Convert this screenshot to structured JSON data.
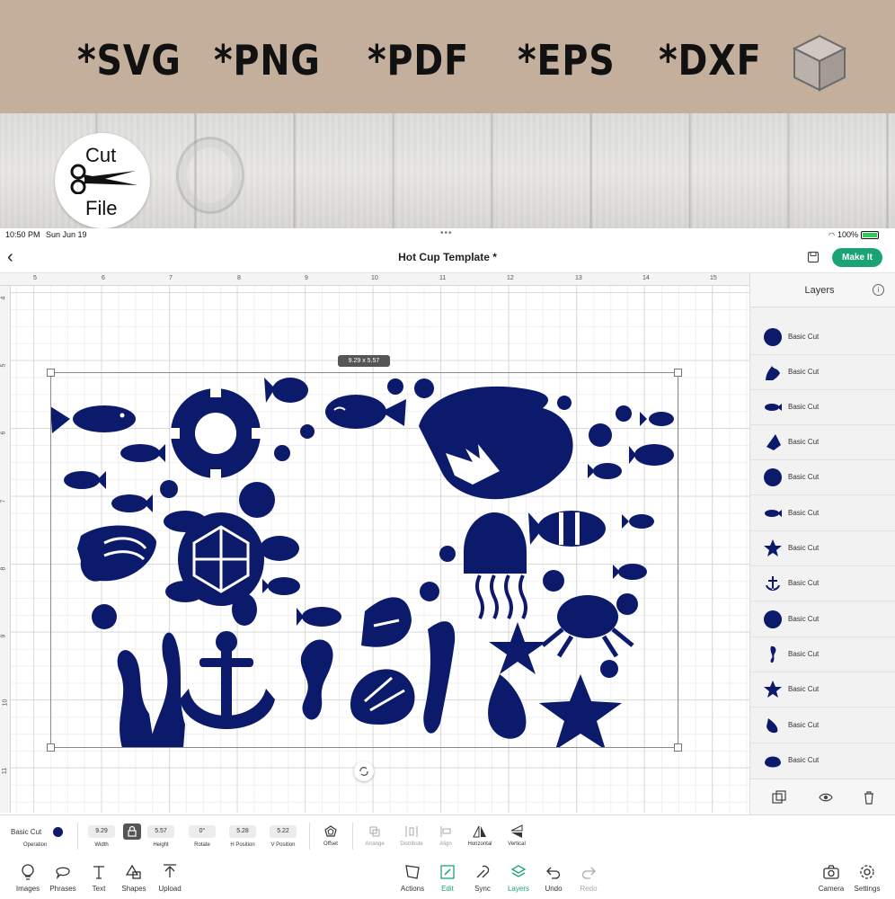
{
  "banner": {
    "formats": [
      "*SVG",
      "*PNG",
      "*PDF",
      "*EPS",
      "*DXF"
    ],
    "badge_line1": "Cut",
    "badge_line2": "File"
  },
  "status_bar": {
    "time": "10:50 PM",
    "date": "Sun Jun 19",
    "battery": "100%"
  },
  "top_nav": {
    "title": "Hot Cup Template *",
    "make_it": "Make It"
  },
  "canvas": {
    "ruler_h": [
      "5",
      "6",
      "7",
      "8",
      "9",
      "10",
      "11",
      "12",
      "13",
      "14",
      "15"
    ],
    "ruler_v": [
      "4",
      "5",
      "6",
      "7",
      "8",
      "9",
      "10",
      "11"
    ],
    "selection_dims": "9.29 x 5.57"
  },
  "layers": {
    "title": "Layers",
    "items": [
      {
        "label": "Basic Cut",
        "icon": "bubble-icon"
      },
      {
        "label": "Basic Cut",
        "icon": "coral-icon"
      },
      {
        "label": "Basic Cut",
        "icon": "fish-icon"
      },
      {
        "label": "Basic Cut",
        "icon": "angelfish-icon"
      },
      {
        "label": "Basic Cut",
        "icon": "bubble-icon"
      },
      {
        "label": "Basic Cut",
        "icon": "fish-icon"
      },
      {
        "label": "Basic Cut",
        "icon": "starfish-icon"
      },
      {
        "label": "Basic Cut",
        "icon": "anchor-icon"
      },
      {
        "label": "Basic Cut",
        "icon": "bubble-icon"
      },
      {
        "label": "Basic Cut",
        "icon": "seahorse-icon"
      },
      {
        "label": "Basic Cut",
        "icon": "starfish-icon"
      },
      {
        "label": "Basic Cut",
        "icon": "shell-icon"
      },
      {
        "label": "Basic Cut",
        "icon": "scallop-icon"
      }
    ]
  },
  "edit_bar": {
    "operation_value": "Basic Cut",
    "operation_label": "Operation",
    "width_value": "9.29",
    "width_label": "Width",
    "height_value": "5.57",
    "height_label": "Height",
    "rotate_value": "0°",
    "rotate_label": "Rotate",
    "hpos_value": "5.28",
    "hpos_label": "H Position",
    "vpos_value": "5.22",
    "vpos_label": "V Position",
    "offset": "Offset",
    "arrange": "Arrange",
    "distribute": "Distribute",
    "align": "Align",
    "horizontal": "Horizontal",
    "vertical": "Vertical"
  },
  "main_bar": {
    "images": "Images",
    "phrases": "Phrases",
    "text": "Text",
    "shapes": "Shapes",
    "upload": "Upload",
    "actions": "Actions",
    "edit": "Edit",
    "sync": "Sync",
    "layers": "Layers",
    "undo": "Undo",
    "redo": "Redo",
    "camera": "Camera",
    "settings": "Settings"
  },
  "colors": {
    "accent": "#1aa376",
    "design": "#0c1a6c",
    "banner": "#c4ae9c"
  }
}
